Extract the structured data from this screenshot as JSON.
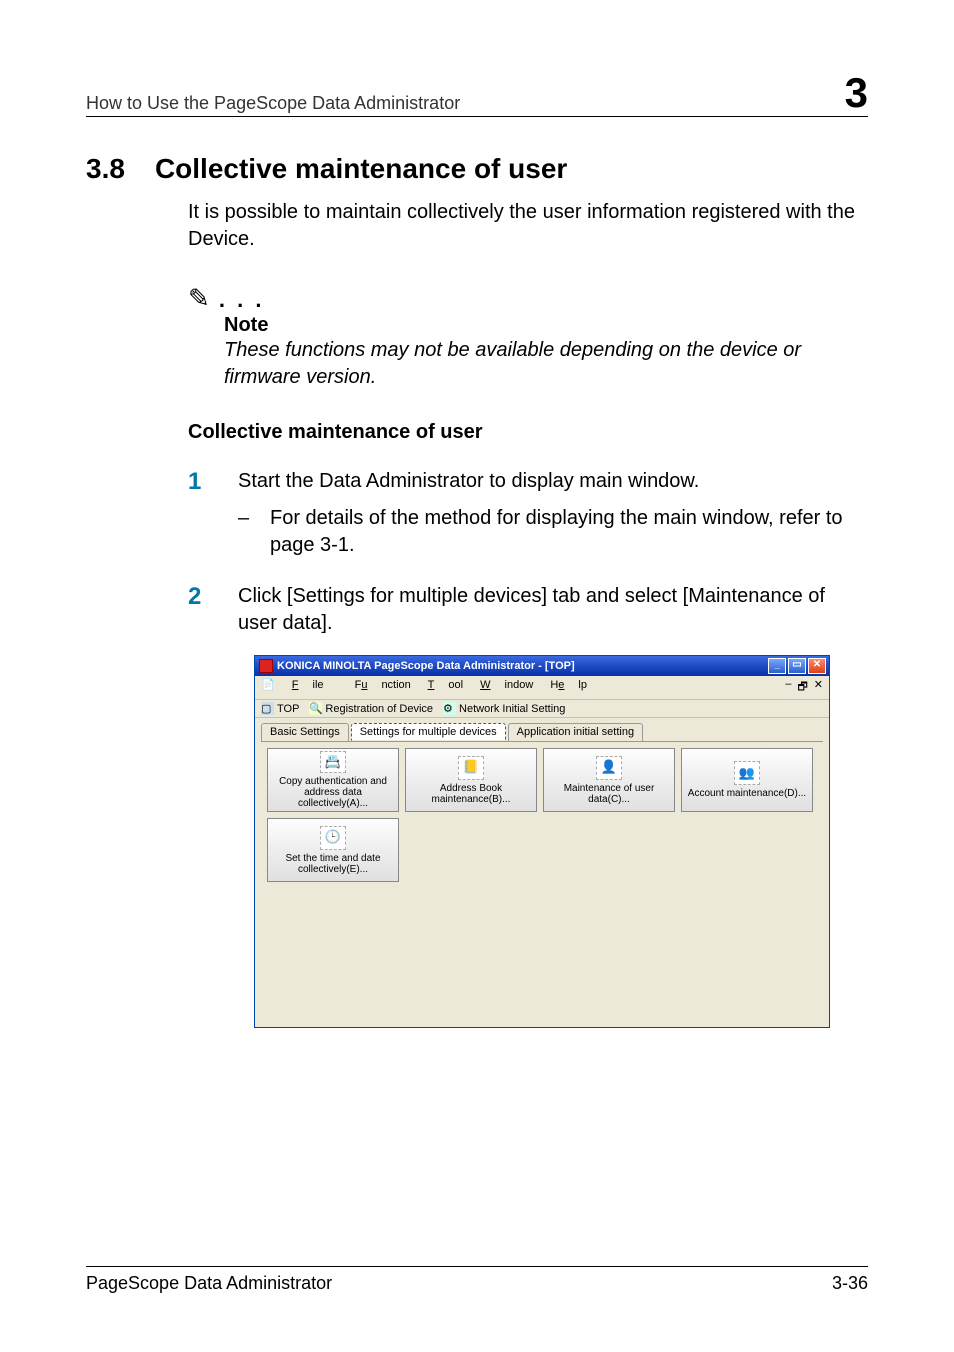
{
  "running_header": "How to Use the PageScope Data Administrator",
  "chapter_num": "3",
  "section_number": "3.8",
  "section_title": "Collective maintenance of user",
  "intro_text": "It is possible to maintain collectively the user information registered with the Device.",
  "note_heading": "Note",
  "note_text": "These functions may not be available depending on the device or firmware version.",
  "subheading": "Collective maintenance of user",
  "steps": [
    {
      "num": "1",
      "text": "Start the Data Administrator to display main window.",
      "sub": "For details of the method for displaying the main window, refer to page 3-1."
    },
    {
      "num": "2",
      "text": "Click [Settings for multiple devices] tab and select [Maintenance of user data].",
      "sub": null
    }
  ],
  "window": {
    "title": "KONICA MINOLTA PageScope Data Administrator - [TOP]",
    "menu": {
      "file": "File",
      "function": "Function",
      "tool": "Tool",
      "window": "Window",
      "help": "Help"
    },
    "toolbar": {
      "top": "TOP",
      "registration": "Registration of Device",
      "network": "Network Initial Setting"
    },
    "tabs": {
      "basic": "Basic Settings",
      "multiple": "Settings for multiple devices",
      "application": "Application initial setting"
    },
    "buttons": {
      "copy_auth": "Copy authentication and address data collectively(A)...",
      "address_book": "Address Book maintenance(B)...",
      "maint_user": "Maintenance of user data(C)...",
      "account_maint": "Account maintenance(D)...",
      "set_time": "Set the time and date collectively(E)..."
    }
  },
  "footer_left": "PageScope Data Administrator",
  "footer_right": "3-36"
}
